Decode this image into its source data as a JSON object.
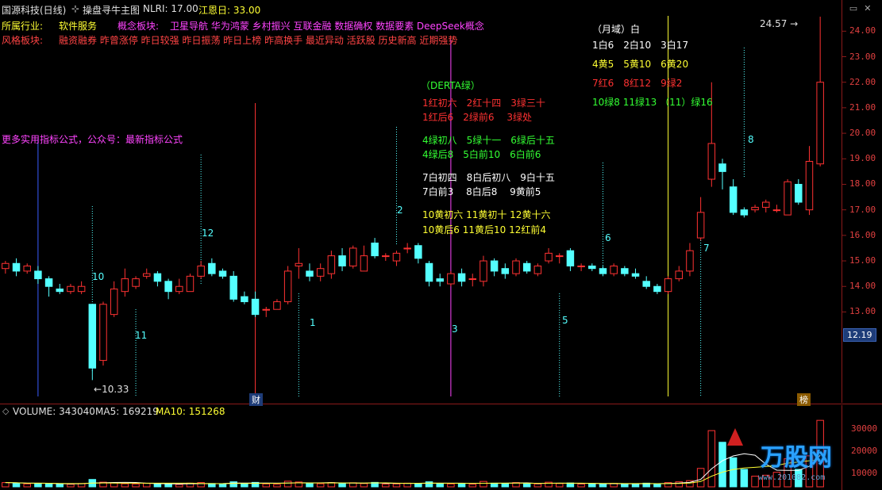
{
  "header": {
    "title": "国源科技(日线)",
    "indicator": "操盘寻牛主图",
    "nlri": "NLRI: 17.00",
    "jiangen": "江恩日: 33.00"
  },
  "industry": {
    "label": "所属行业:",
    "value": "软件服务"
  },
  "concept": {
    "label": "概念板块:",
    "value": "卫星导航 华为鸿蒙 乡村振兴 互联金融 数据确权 数据要素 DeepSeek概念"
  },
  "style": {
    "label": "风格板块:",
    "value": "融资融券 昨曾涨停 昨日较强 昨日振荡 昨日上榜 昨高换手 最近异动 活跃股 历史新高 近期强势"
  },
  "promo_text": "更多实用指标公式，公众号：最新指标公式",
  "overlay": {
    "derta": "（DERTA绿）",
    "red_rows": [
      "1红初六　2红十四　3绿三十",
      "1红后6　2绿前6　 3绿处"
    ],
    "green_rows": [
      "4绿初八　5绿十一　6绿后十五",
      "4绿后8　5白前10　6白前6"
    ],
    "white_rows": [
      "7白初四　8白后初八　9白十五",
      "7白前3　 8白后8　 9黄前5"
    ],
    "yellow_rows": [
      "10黄初六 11黄初十 12黄十六",
      "10黄后6 11黄后10 12红前4"
    ],
    "month_title": "（月域）白",
    "month_rows": [
      "1白6　2白10　3白17",
      "4黄5　5黄10　6黄20",
      "7红6　8红12　9绿2",
      "10绿8 11绿13 （11）绿16"
    ]
  },
  "markers": {
    "n1": "1",
    "n2": "2",
    "n3": "3",
    "n5": "5",
    "n6": "6",
    "n7": "7",
    "n8": "8",
    "n10": "10",
    "n11": "11",
    "n12": "12"
  },
  "annotations": {
    "high": "24.57",
    "low": "10.33",
    "cai": "财",
    "bang": "榜"
  },
  "price_axis": [
    "24.00",
    "23.00",
    "22.00",
    "21.00",
    "20.00",
    "19.00",
    "18.00",
    "17.00",
    "16.00",
    "15.00",
    "14.00",
    "13.00"
  ],
  "current_price": "12.19",
  "volume": {
    "label": "VOLUME: 343040",
    "ma5": "MA5: 169219",
    "ma10": "MA10: 151268",
    "axis": [
      "30000",
      "20000",
      "10000"
    ]
  },
  "watermark": {
    "logo": "万股网",
    "url": "www.201082.com"
  },
  "colors": {
    "up": "#ff3232",
    "down": "#54ffff",
    "bg": "#000000",
    "border": "#8b1a1a"
  },
  "chart_data": {
    "type": "candlestick",
    "title": "",
    "ylim": [
      10.0,
      24.6
    ],
    "high_value": 24.57,
    "low_value": 10.33,
    "candles": [
      {
        "o": 14.7,
        "c": 14.9,
        "h": 15.0,
        "l": 14.5
      },
      {
        "o": 14.9,
        "c": 14.6,
        "h": 15.1,
        "l": 14.4
      },
      {
        "o": 14.6,
        "c": 14.8,
        "h": 14.9,
        "l": 14.5
      },
      {
        "o": 14.6,
        "c": 14.3,
        "h": 14.8,
        "l": 14.1
      },
      {
        "o": 14.3,
        "c": 14.0,
        "h": 14.4,
        "l": 13.6
      },
      {
        "o": 13.9,
        "c": 13.8,
        "h": 14.1,
        "l": 13.7
      },
      {
        "o": 13.8,
        "c": 14.0,
        "h": 14.1,
        "l": 13.7
      },
      {
        "o": 13.8,
        "c": 14.0,
        "h": 14.2,
        "l": 13.7
      },
      {
        "o": 13.3,
        "c": 10.8,
        "h": 13.3,
        "l": 10.33
      },
      {
        "o": 11.1,
        "c": 13.3,
        "h": 13.4,
        "l": 10.9
      },
      {
        "o": 12.9,
        "c": 13.9,
        "h": 14.2,
        "l": 12.8
      },
      {
        "o": 13.8,
        "c": 14.3,
        "h": 14.7,
        "l": 13.6
      },
      {
        "o": 14.0,
        "c": 14.3,
        "h": 14.4,
        "l": 13.9
      },
      {
        "o": 14.4,
        "c": 14.5,
        "h": 14.7,
        "l": 14.3
      },
      {
        "o": 14.5,
        "c": 14.2,
        "h": 14.6,
        "l": 14.0
      },
      {
        "o": 14.2,
        "c": 13.8,
        "h": 14.3,
        "l": 13.5
      },
      {
        "o": 13.8,
        "c": 14.0,
        "h": 14.3,
        "l": 13.7
      },
      {
        "o": 13.8,
        "c": 14.4,
        "h": 14.5,
        "l": 13.8
      },
      {
        "o": 14.4,
        "c": 14.8,
        "h": 15.0,
        "l": 14.3
      },
      {
        "o": 14.9,
        "c": 14.5,
        "h": 15.1,
        "l": 14.4
      },
      {
        "o": 14.6,
        "c": 14.4,
        "h": 14.7,
        "l": 14.3
      },
      {
        "o": 14.4,
        "c": 13.5,
        "h": 14.6,
        "l": 13.4
      },
      {
        "o": 13.6,
        "c": 13.4,
        "h": 13.8,
        "l": 13.3
      },
      {
        "o": 13.5,
        "c": 12.9,
        "h": 13.8,
        "l": 12.8
      },
      {
        "o": 13.1,
        "c": 13.1,
        "h": 13.2,
        "l": 12.8
      },
      {
        "o": 13.1,
        "c": 13.4,
        "h": 13.5,
        "l": 13.1
      },
      {
        "o": 13.4,
        "c": 14.6,
        "h": 14.8,
        "l": 13.3
      },
      {
        "o": 14.8,
        "c": 14.9,
        "h": 15.5,
        "l": 14.3
      },
      {
        "o": 14.6,
        "c": 14.4,
        "h": 14.9,
        "l": 14.2
      },
      {
        "o": 14.4,
        "c": 14.7,
        "h": 14.9,
        "l": 14.2
      },
      {
        "o": 14.5,
        "c": 15.2,
        "h": 15.4,
        "l": 14.3
      },
      {
        "o": 15.2,
        "c": 14.8,
        "h": 15.5,
        "l": 14.6
      },
      {
        "o": 14.8,
        "c": 15.5,
        "h": 15.6,
        "l": 14.7
      },
      {
        "o": 14.6,
        "c": 15.2,
        "h": 15.6,
        "l": 14.6
      },
      {
        "o": 15.7,
        "c": 15.2,
        "h": 15.9,
        "l": 15.1
      },
      {
        "o": 15.2,
        "c": 15.2,
        "h": 15.3,
        "l": 15.0
      },
      {
        "o": 15.0,
        "c": 15.3,
        "h": 15.4,
        "l": 14.8
      },
      {
        "o": 15.5,
        "c": 15.5,
        "h": 15.7,
        "l": 15.3
      },
      {
        "o": 15.6,
        "c": 15.1,
        "h": 15.7,
        "l": 14.9
      },
      {
        "o": 14.9,
        "c": 14.2,
        "h": 15.0,
        "l": 14.0
      },
      {
        "o": 14.3,
        "c": 14.2,
        "h": 14.5,
        "l": 14.0
      },
      {
        "o": 14.1,
        "c": 14.5,
        "h": 14.6,
        "l": 14.0
      },
      {
        "o": 14.5,
        "c": 14.2,
        "h": 14.7,
        "l": 14.0
      },
      {
        "o": 14.3,
        "c": 14.3,
        "h": 14.5,
        "l": 14.0
      },
      {
        "o": 14.2,
        "c": 15.0,
        "h": 15.2,
        "l": 14.0
      },
      {
        "o": 15.0,
        "c": 14.6,
        "h": 15.1,
        "l": 14.4
      },
      {
        "o": 14.7,
        "c": 14.5,
        "h": 14.9,
        "l": 14.3
      },
      {
        "o": 14.5,
        "c": 15.0,
        "h": 15.1,
        "l": 14.4
      },
      {
        "o": 14.9,
        "c": 14.6,
        "h": 15.0,
        "l": 14.5
      },
      {
        "o": 14.5,
        "c": 14.8,
        "h": 14.9,
        "l": 14.4
      },
      {
        "o": 15.0,
        "c": 15.3,
        "h": 15.5,
        "l": 14.9
      },
      {
        "o": 15.2,
        "c": 15.2,
        "h": 15.3,
        "l": 14.9
      },
      {
        "o": 15.4,
        "c": 14.8,
        "h": 15.5,
        "l": 14.6
      },
      {
        "o": 14.8,
        "c": 14.8,
        "h": 14.9,
        "l": 14.6
      },
      {
        "o": 14.8,
        "c": 14.7,
        "h": 14.9,
        "l": 14.6
      },
      {
        "o": 14.7,
        "c": 14.5,
        "h": 14.8,
        "l": 14.4
      },
      {
        "o": 14.5,
        "c": 14.8,
        "h": 14.9,
        "l": 14.4
      },
      {
        "o": 14.7,
        "c": 14.5,
        "h": 14.8,
        "l": 14.4
      },
      {
        "o": 14.5,
        "c": 14.4,
        "h": 14.7,
        "l": 14.3
      },
      {
        "o": 14.2,
        "c": 14.0,
        "h": 14.4,
        "l": 13.9
      },
      {
        "o": 14.0,
        "c": 13.8,
        "h": 14.1,
        "l": 13.7
      },
      {
        "o": 13.8,
        "c": 14.3,
        "h": 14.4,
        "l": 13.7
      },
      {
        "o": 14.3,
        "c": 14.6,
        "h": 14.8,
        "l": 14.2
      },
      {
        "o": 14.6,
        "c": 15.4,
        "h": 15.7,
        "l": 14.4
      },
      {
        "o": 15.9,
        "c": 16.9,
        "h": 17.5,
        "l": 15.8
      },
      {
        "o": 18.2,
        "c": 19.6,
        "h": 22.0,
        "l": 17.9
      },
      {
        "o": 18.8,
        "c": 18.5,
        "h": 19.0,
        "l": 17.8
      },
      {
        "o": 17.9,
        "c": 16.9,
        "h": 18.2,
        "l": 16.8
      },
      {
        "o": 17.0,
        "c": 16.8,
        "h": 17.1,
        "l": 16.7
      },
      {
        "o": 17.0,
        "c": 17.1,
        "h": 17.2,
        "l": 16.9
      },
      {
        "o": 17.1,
        "c": 17.3,
        "h": 17.4,
        "l": 16.9
      },
      {
        "o": 17.0,
        "c": 17.0,
        "h": 17.2,
        "l": 16.9
      },
      {
        "o": 16.8,
        "c": 18.1,
        "h": 18.2,
        "l": 16.8
      },
      {
        "o": 18.0,
        "c": 17.3,
        "h": 18.2,
        "l": 17.2
      },
      {
        "o": 17.0,
        "c": 18.9,
        "h": 19.5,
        "l": 16.8
      },
      {
        "o": 18.8,
        "c": 22.0,
        "h": 24.57,
        "l": 18.7
      }
    ],
    "volume": [
      2.2,
      2.0,
      1.5,
      1.8,
      1.6,
      1.4,
      1.3,
      1.7,
      3.8,
      2.4,
      2.0,
      1.6,
      1.5,
      1.8,
      1.6,
      1.3,
      1.2,
      1.9,
      2.2,
      1.7,
      1.4,
      2.6,
      1.8,
      2.3,
      1.5,
      1.3,
      2.9,
      2.5,
      1.9,
      1.6,
      2.2,
      1.8,
      2.1,
      1.7,
      2.3,
      1.4,
      1.5,
      1.9,
      1.8,
      2.6,
      1.7,
      1.5,
      1.8,
      1.3,
      2.8,
      1.9,
      1.6,
      2.2,
      1.6,
      1.5,
      2.4,
      1.7,
      2.0,
      1.4,
      1.5,
      1.6,
      1.8,
      1.6,
      1.4,
      1.9,
      1.6,
      2.2,
      2.6,
      3.2,
      9.5,
      29.0,
      23.0,
      15.0,
      9.0,
      5.5,
      6.0,
      7.5,
      14.5,
      9.0,
      16.0,
      34.3
    ]
  }
}
